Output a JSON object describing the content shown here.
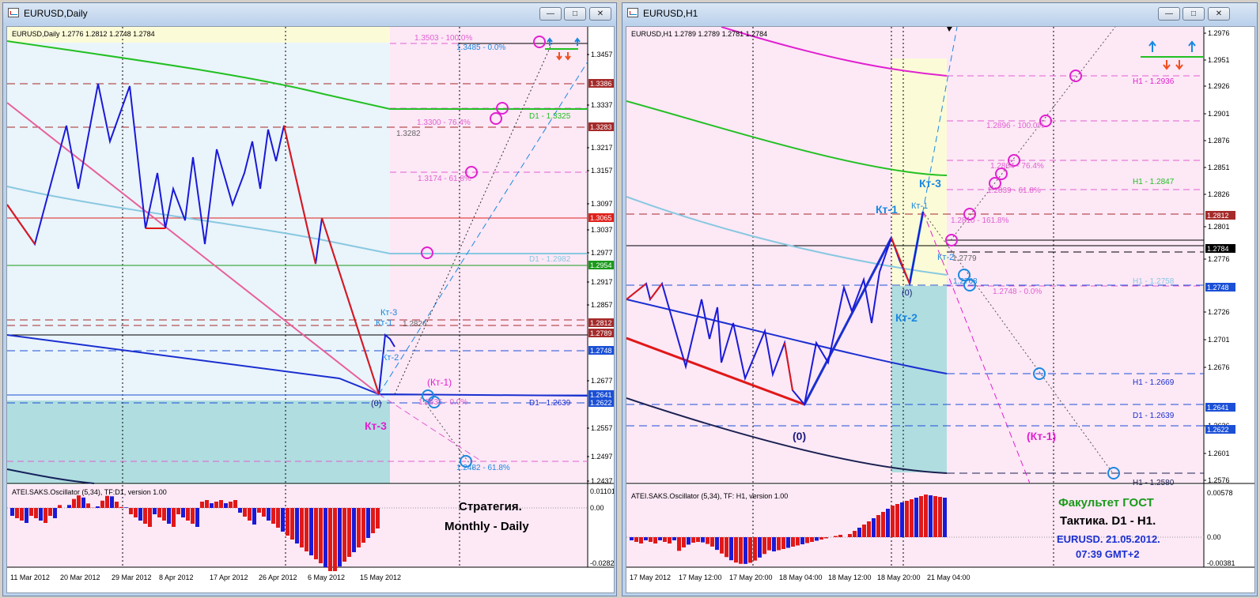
{
  "windows": [
    {
      "title": "EURUSD,Daily",
      "info_line": "EURUSD,Daily  1.2776 1.2812 1.2748 1.2784",
      "price_labels": [
        {
          "text": "1.3457",
          "kind": "tick"
        },
        {
          "text": "1.3386",
          "kind": "box",
          "color": "#a52a2a"
        },
        {
          "text": "1.3337",
          "kind": "tick"
        },
        {
          "text": "1.3283",
          "kind": "box",
          "color": "#a52a2a"
        },
        {
          "text": "1.3217",
          "kind": "tick"
        },
        {
          "text": "1.3157",
          "kind": "tick"
        },
        {
          "text": "1.3097",
          "kind": "tick"
        },
        {
          "text": "1.3065",
          "kind": "box",
          "color": "#e0201a"
        },
        {
          "text": "1.3037",
          "kind": "tick"
        },
        {
          "text": "1.2977",
          "kind": "tick"
        },
        {
          "text": "1.2954",
          "kind": "box",
          "color": "#1a9a1a"
        },
        {
          "text": "1.2917",
          "kind": "tick"
        },
        {
          "text": "1.2857",
          "kind": "tick"
        },
        {
          "text": "1.2812",
          "kind": "box",
          "color": "#a52a2a"
        },
        {
          "text": "1.2789",
          "kind": "box",
          "color": "#a52a2a"
        },
        {
          "text": "1.2748",
          "kind": "box",
          "color": "#1a4fd6"
        },
        {
          "text": "1.2677",
          "kind": "tick"
        },
        {
          "text": "1.2641",
          "kind": "box",
          "color": "#1a4fd6"
        },
        {
          "text": "1.2622",
          "kind": "box",
          "color": "#1a4fd6"
        },
        {
          "text": "1.2557",
          "kind": "tick"
        },
        {
          "text": "1.2497",
          "kind": "tick"
        },
        {
          "text": "1.2437",
          "kind": "tick"
        }
      ],
      "annotations": {
        "fib_100": "1.3503 - 100.0%",
        "fib_0": "1.3485 - 0.0%",
        "fib_76": "1.3300 - 76.4%",
        "val_3282": "1.3282",
        "fib_618": "1.3174 - 61.8%",
        "d1_3325": "D1 - 1.3325",
        "d1_2982": "D1 - 1.2982",
        "d1_2639": "D1 - 1.2639",
        "kt3_small": "Кт-3",
        "kt1_small": "Кт-1",
        "val_2826": "1.2826",
        "kt2_small": "Кт-2",
        "kt1_paren": "(Кт-1)",
        "fib_low_0": "1.2635 - 0.0%",
        "zero": "(0)",
        "kt3_big": "Кт-3",
        "fib_low_618": "1.2482 - 61.8%"
      },
      "osc": {
        "label": "ATEI.SAKS.Oscillator (5,34), TF:D1, version 1.00",
        "scale": [
          "0.01101",
          "0.00",
          "-0.02827"
        ]
      },
      "strategy": [
        "Стратегия.",
        "Monthly - Daily"
      ],
      "dates": [
        "11 Mar 2012",
        "20 Mar 2012",
        "29 Mar 2012",
        "8 Apr 2012",
        "17 Apr 2012",
        "26 Apr 2012",
        "6 May 2012",
        "15 May 2012"
      ]
    },
    {
      "title": "EURUSD,H1",
      "info_line": "EURUSD,H1  1.2789 1.2789 1.2781 1.2784",
      "price_labels": [
        {
          "text": "1.2976",
          "kind": "tick"
        },
        {
          "text": "1.2951",
          "kind": "tick"
        },
        {
          "text": "1.2926",
          "kind": "tick"
        },
        {
          "text": "1.2901",
          "kind": "tick"
        },
        {
          "text": "1.2876",
          "kind": "tick"
        },
        {
          "text": "1.2851",
          "kind": "tick"
        },
        {
          "text": "1.2826",
          "kind": "tick"
        },
        {
          "text": "1.2812",
          "kind": "box",
          "color": "#a52a2a"
        },
        {
          "text": "1.2801",
          "kind": "tick"
        },
        {
          "text": "1.2784",
          "kind": "box",
          "color": "#000000"
        },
        {
          "text": "1.2776",
          "kind": "tick"
        },
        {
          "text": "1.2748",
          "kind": "box",
          "color": "#1a4fd6"
        },
        {
          "text": "1.2726",
          "kind": "tick"
        },
        {
          "text": "1.2701",
          "kind": "tick"
        },
        {
          "text": "1.2676",
          "kind": "tick"
        },
        {
          "text": "1.2641",
          "kind": "box",
          "color": "#1a4fd6"
        },
        {
          "text": "1.2626",
          "kind": "tick"
        },
        {
          "text": "1.2622",
          "kind": "box",
          "color": "#1a4fd6"
        },
        {
          "text": "1.2601",
          "kind": "tick"
        },
        {
          "text": "1.2576",
          "kind": "tick"
        }
      ],
      "annotations": {
        "h1_2936": "H1 - 1.2936",
        "fib_896": "1.2896 - 100.0%",
        "fib_864": "1.2864 - 76.4%",
        "h1_2847": "H1 - 1.2847",
        "fib_839": "1.2839 - 61.8%",
        "kt3_big": "Кт-3",
        "kt1_big": "Кт-1",
        "kt1_small": "Кт-1",
        "fib_1618": "1.2810 - 161.8%",
        "kt2_small": "Кт-2",
        "val_2779": "1.2779",
        "val_2768": "1.2768",
        "zero_small": "(0)",
        "fib_748": "1.2748 - 0.0%",
        "h1_2758": "H1 - 1.2758",
        "kt2_big": "Кт-2",
        "h1_2669": "H1 - 1.2669",
        "d1_2639": "D1 - 1.2639",
        "zero_big": "(0)",
        "kt1_paren": "(Кт-1)",
        "h1_2580": "H1 - 1.2580"
      },
      "osc": {
        "label": "ATEI.SAKS.Oscillator (5,34), TF: H1, version 1.00",
        "scale": [
          "0.00578",
          "0.00",
          "-0.00381"
        ]
      },
      "faculty": [
        "Факультет ГОСТ",
        "Тактика. D1 - H1.",
        "EURUSD. 21.05.2012.",
        "07:39  GMT+2"
      ],
      "dates": [
        "17 May 2012",
        "17 May 12:00",
        "17 May 20:00",
        "18 May 04:00",
        "18 May 12:00",
        "18 May 20:00",
        "21 May 04:00"
      ]
    }
  ],
  "colors": {
    "bull": "#1a1ad8",
    "bear": "#e01818",
    "fib": "#e060d0",
    "ma_green": "#22c022",
    "ma_lightblue": "#88c8e0",
    "ma_magenta": "#e020d0"
  }
}
